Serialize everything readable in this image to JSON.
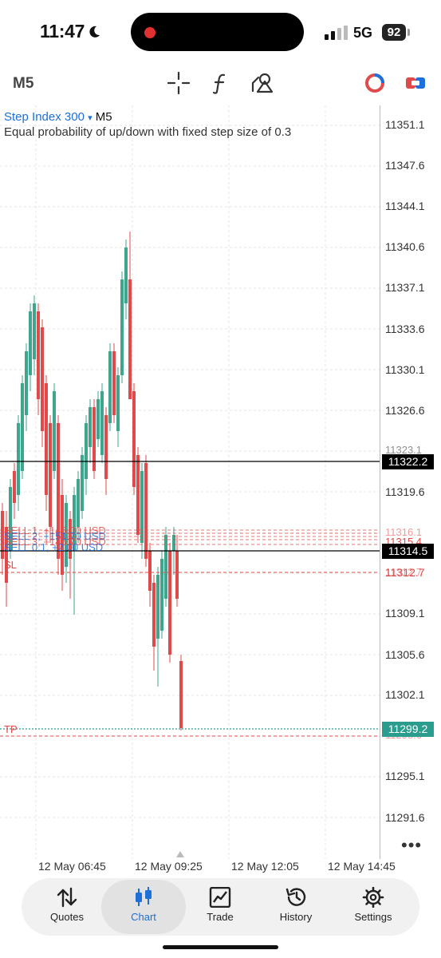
{
  "status_bar": {
    "time": "11:47",
    "network": "5G",
    "battery": "92"
  },
  "toolbar": {
    "timeframe": "M5"
  },
  "chart_header": {
    "symbol": "Step Index 300",
    "dropdown_glyph": "▾",
    "timeframe": "M5",
    "description": "Equal probability of up/down with fixed step size of 0.3"
  },
  "price_axis": [
    "11351.1",
    "11347.6",
    "11344.1",
    "11340.6",
    "11337.1",
    "11333.6",
    "11330.1",
    "11326.6",
    "11323.1",
    "11319.6",
    "11316.1",
    "11312.7",
    "11309.1",
    "11305.6",
    "11302.1",
    "11298.6",
    "11295.1",
    "11291.6"
  ],
  "price_tags": {
    "level_black_1": "11322.2",
    "bid": "11314.5",
    "sl": "11315.4",
    "sl2": "11312.7",
    "tp": "11299.2"
  },
  "trade_lines": {
    "labels": [
      "SELL 1, +146.00 USD",
      "SELL 2, +151.70 USD",
      "SELL 3, +145.70 USD",
      "SELL 0.1, +2.00 USD"
    ],
    "sl": "SL",
    "tp": "TP"
  },
  "time_axis": [
    "12 May 06:45",
    "12 May 09:25",
    "12 May 12:05",
    "12 May 14:45"
  ],
  "more_glyph": "•••",
  "tabs": [
    {
      "label": "Quotes",
      "icon": "quotes-icon"
    },
    {
      "label": "Chart",
      "icon": "chart-icon",
      "active": true
    },
    {
      "label": "Trade",
      "icon": "trade-icon"
    },
    {
      "label": "History",
      "icon": "history-icon"
    },
    {
      "label": "Settings",
      "icon": "settings-icon"
    }
  ],
  "colors": {
    "bull": "#3fa58c",
    "bear": "#e04a4a",
    "accent": "#1e6fd9",
    "tp_line": "#2a9d8f"
  }
}
